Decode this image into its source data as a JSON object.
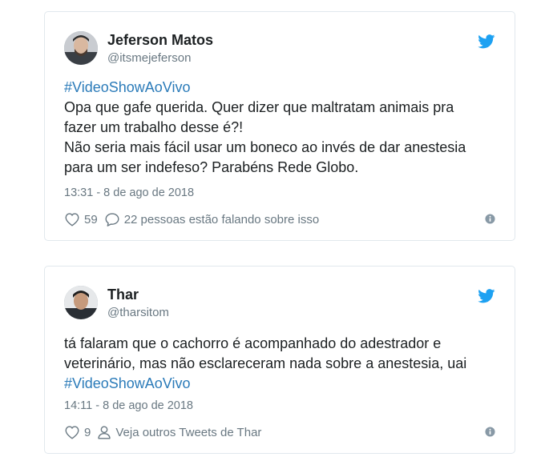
{
  "colors": {
    "link": "#2b7bb9",
    "text": "#1c2022",
    "muted": "#697882",
    "border": "#e1e8ed",
    "twitter_blue": "#1da1f2"
  },
  "tweets": [
    {
      "author": {
        "name": "Jeferson Matos",
        "handle": "@itsmejeferson",
        "avatar_icon": "avatar-photo-icon"
      },
      "hashtag": "#VideoShowAoVivo",
      "text_lines": [
        "Opa que gafe querida. Quer dizer que maltratam animais pra",
        "fazer um trabalho desse é?!",
        "Não seria mais fácil usar um boneco ao invés de dar anestesia",
        "para um ser indefeso? Parabéns Rede Globo."
      ],
      "timestamp": "13:31 - 8 de ago de 2018",
      "likes": "59",
      "secondary_action": "22 pessoas estão falando sobre isso",
      "secondary_icon": "speech-bubble-icon"
    },
    {
      "author": {
        "name": "Thar",
        "handle": "@tharsitom",
        "avatar_icon": "avatar-photo-icon"
      },
      "text_lines": [
        "tá falaram que o cachorro é acompanhado do adestrador e",
        "veterinário, mas não esclareceram nada sobre a anestesia, uai"
      ],
      "hashtag": "#VideoShowAoVivo",
      "timestamp": "14:11 - 8 de ago de 2018",
      "likes": "9",
      "secondary_action": "Veja outros Tweets de Thar",
      "secondary_icon": "person-icon"
    }
  ]
}
